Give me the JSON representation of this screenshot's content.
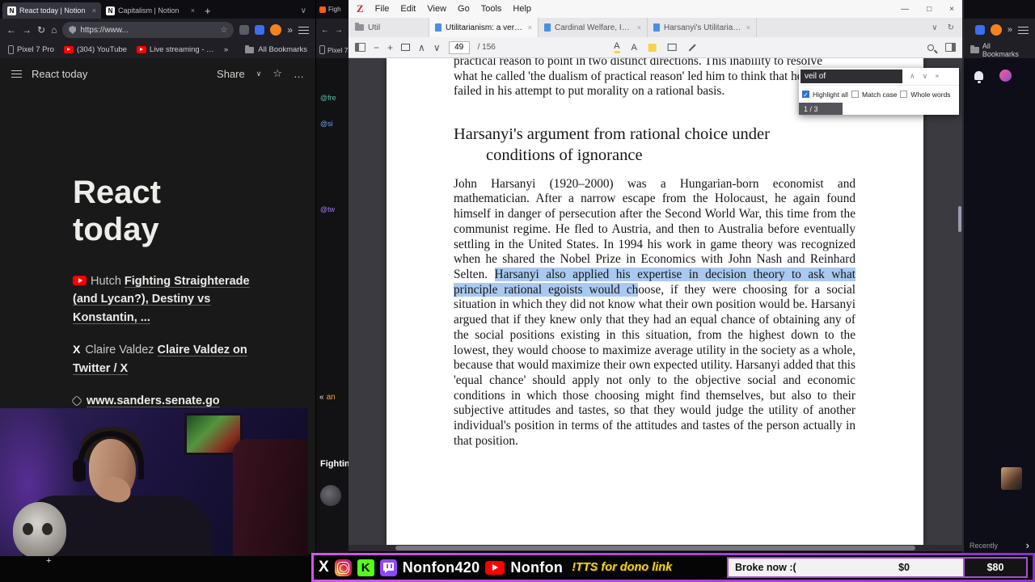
{
  "icons": {
    "back": "←",
    "forward": "→",
    "reload": "↻",
    "home": "⌂",
    "menu": "☰",
    "overflow": "»",
    "chevron_down": "∨",
    "chevron_up": "∧",
    "close": "×",
    "plus": "+",
    "star": "☆",
    "more": "…",
    "minimize": "—",
    "maximize": "□",
    "zoom_out": "−",
    "zoom_in": "+",
    "collapse": "«",
    "chevron_right": "›",
    "check": "✓",
    "notion_fav": "N",
    "x_logo": "X",
    "kick_logo": "K",
    "highlight_tool": "A",
    "text_tool": "A"
  },
  "colors": {
    "accent_purple": "#b44fd4",
    "twitch_purple": "#9146ff",
    "kick_green": "#53fc18",
    "youtube_red": "#ff0000",
    "selection_blue": "#aac9f0",
    "tts_yellow": "#f2d41c"
  },
  "left_browser": {
    "tab1": "React today | Notion",
    "tab2": "Capitalism | Notion",
    "url": "https://www...",
    "bookmark1": "Pixel 7 Pro",
    "bookmark2": "(304) YouTube",
    "bookmark3": "Live streaming - YouTube",
    "all_bookmarks": "All Bookmarks",
    "notion_breadcrumb": "React today",
    "share": "Share",
    "title": "React today",
    "item1_prefix": "Hutch",
    "item1_text": "Fighting Straighterade (and Lycan?), Destiny vs Konstantin, ...",
    "item2_prefix": "Claire Valdez",
    "item2_text": "Claire Valdez on Twitter / X",
    "item3_text": "www.sanders.senate.go"
  },
  "mid_window": {
    "tab": "Figh",
    "bookmark": "Pixel 7",
    "chat1": "@fre",
    "chat2": "@si",
    "chat3": "@tw",
    "chat4": "an",
    "title": "Fightin"
  },
  "zotero": {
    "menu1": "File",
    "menu2": "Edit",
    "menu3": "View",
    "menu4": "Go",
    "menu5": "Tools",
    "menu6": "Help",
    "library_tab": "Util",
    "tab1": "Utilitarianism: a very short",
    "tab2": "Cardinal Welfare, Individu",
    "tab3": "Harsanyi's Utilitarian Theo",
    "page_current": "49",
    "page_total": "/ 156",
    "find_query": "veil of",
    "find_highlight_all": "Highlight all",
    "find_match_case": "Match case",
    "find_whole_words": "Whole words",
    "find_results": "1 / 3",
    "pdf_top_line1": "practical reason to point in two distinct directions. This inability to resolve",
    "pdf_top_line2": "what he called 'the dualism of practical reason' led him to think that he",
    "pdf_top_line3": "failed in his attempt to put morality on a rational basis.",
    "heading_line1": "Harsanyi's argument from rational choice under",
    "heading_line2": "conditions of ignorance",
    "body_pre": "John Harsanyi (1920–2000) was a Hungarian-born economist and mathematician. After a narrow escape from the Holocaust, he again found himself in danger of persecution after the Second World War, this time from the communist regime. He fled to Austria, and then to Australia before eventually settling in the United States. In 1994 his work in game theory was recognized when he shared the Nobel Prize in Economics with John Nash and Reinhard Selten. ",
    "body_selected": "Harsanyi also applied his expertise in decision theory to ask what principle rational egoists would ch",
    "body_post": "oose, if they were choosing for a social situation in which they did not know what their own position would be. Harsanyi argued that if they knew only that they had an equal chance of obtaining any of the social positions existing in this situation, from the highest down to the lowest, they would choose to maximize average utility in the society as a whole, because that would maximize their own expected utility. Harsanyi added that this 'equal chance' should apply not only to the objective social and economic conditions in which those choosing might find themselves, but also to their subjective attitudes and tastes, so that they would judge the utility of another individual's position in terms of the attitudes and tastes of the person actually in that position."
  },
  "right_browser": {
    "all_bookmarks": "All Bookmarks",
    "recently": "Recently"
  },
  "stream_bar": {
    "handle_main": "Nonfon420",
    "handle_youtube": "Nonfon",
    "tts": "!TTS for dono link",
    "goal_label": "Broke now :(",
    "goal_current": "$0",
    "goal_target": "$80"
  }
}
